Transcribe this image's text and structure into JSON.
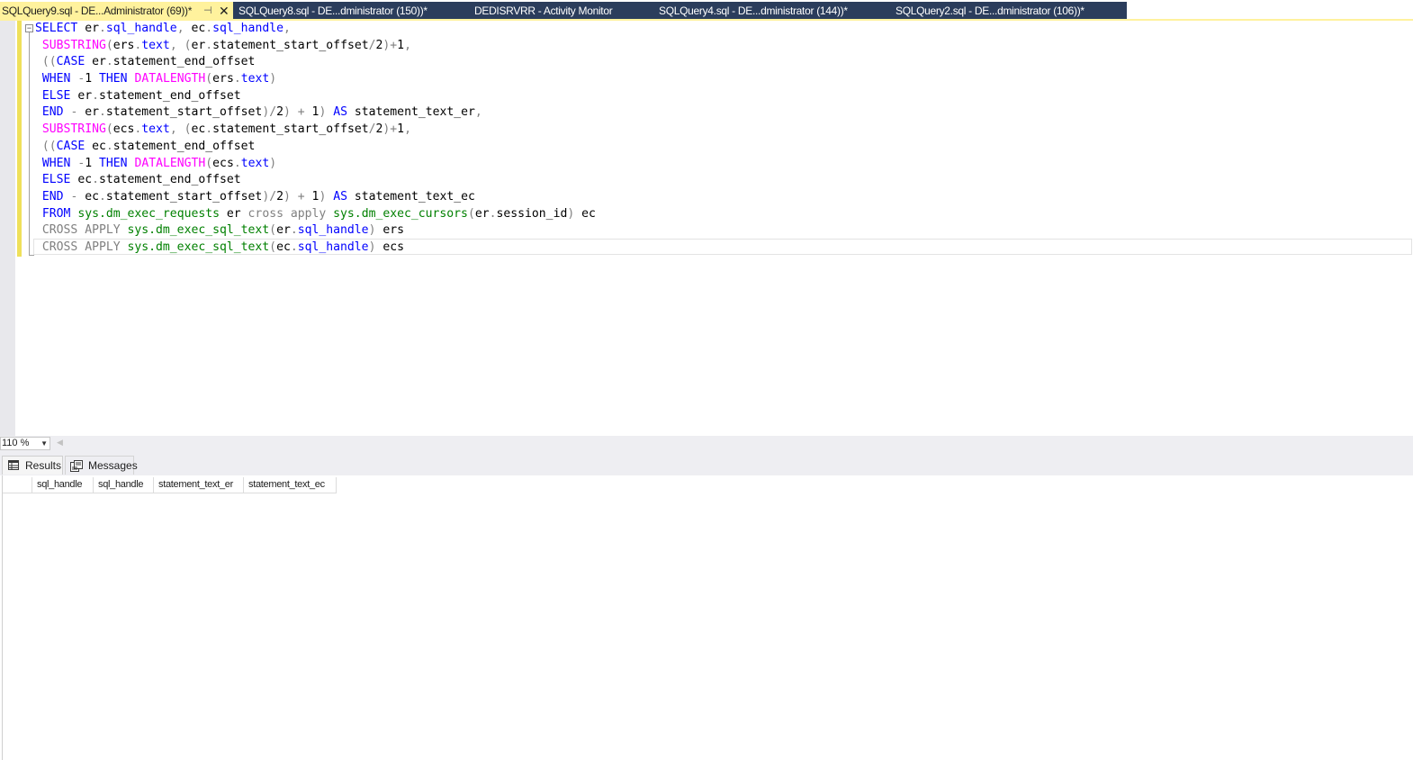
{
  "tabs": [
    {
      "label": "SQLQuery9.sql - DE...Administrator (69))*",
      "active": true
    },
    {
      "label": "SQLQuery8.sql - DE...dministrator (150))*",
      "active": false
    },
    {
      "label": "DEDISRVRR - Activity Monitor",
      "active": false
    },
    {
      "label": "SQLQuery4.sql - DE...dministrator (144))*",
      "active": false
    },
    {
      "label": "SQLQuery2.sql - DE...dministrator (106))*",
      "active": false
    }
  ],
  "active_tab_icons": {
    "pin": "pin-icon",
    "close": "close-icon"
  },
  "colors": {
    "tab_active_bg": "#fff29d",
    "tab_inactive_bg": "#2b3d5c",
    "keyword": "#0000ff",
    "function": "#ff00ff",
    "system_object": "#008000",
    "operator": "#808080"
  },
  "editor": {
    "lines": [
      "SELECT er.sql_handle, ec.sql_handle,",
      " SUBSTRING(ers.text, (er.statement_start_offset/2)+1,",
      " ((CASE er.statement_end_offset",
      " WHEN -1 THEN DATALENGTH(ers.text)",
      " ELSE er.statement_end_offset",
      " END - er.statement_start_offset)/2) + 1) AS statement_text_er,",
      " SUBSTRING(ecs.text, (ec.statement_start_offset/2)+1,",
      " ((CASE ec.statement_end_offset",
      " WHEN -1 THEN DATALENGTH(ecs.text)",
      " ELSE ec.statement_end_offset",
      " END - ec.statement_start_offset)/2) + 1) AS statement_text_ec",
      " FROM sys.dm_exec_requests er cross apply sys.dm_exec_cursors(er.session_id) ec",
      " CROSS APPLY sys.dm_exec_sql_text(er.sql_handle) ers",
      " CROSS APPLY sys.dm_exec_sql_text(ec.sql_handle) ecs"
    ]
  },
  "zoom": {
    "value": "110 %"
  },
  "results": {
    "tabs": [
      {
        "label": "Results",
        "icon": "grid-icon"
      },
      {
        "label": "Messages",
        "icon": "messages-icon"
      }
    ],
    "columns": [
      "sql_handle",
      "sql_handle",
      "statement_text_er",
      "statement_text_ec"
    ],
    "rows": []
  }
}
